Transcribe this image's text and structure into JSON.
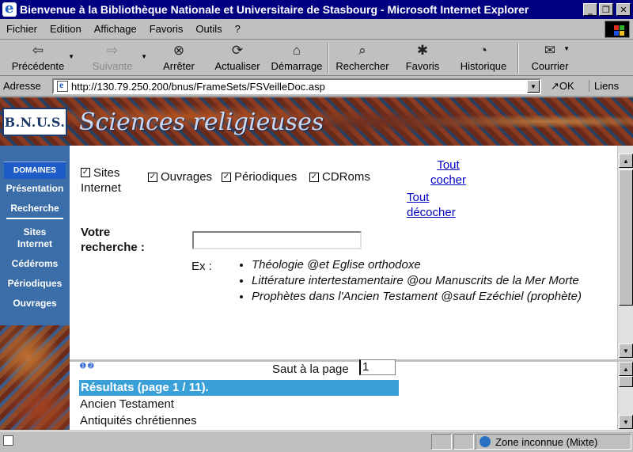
{
  "window": {
    "title": "Bienvenue à la Bibliothèque Nationale et Universitaire de Stasbourg - Microsoft Internet Explorer",
    "minimize": "_",
    "maximize": "❐",
    "close": "✕"
  },
  "menu": [
    "Fichier",
    "Edition",
    "Affichage",
    "Favoris",
    "Outils",
    "?"
  ],
  "toolbar": {
    "back": "Précédente",
    "forward": "Suivante",
    "stop": "Arrêter",
    "refresh": "Actualiser",
    "home": "Démarrage",
    "search": "Rechercher",
    "favorites": "Favoris",
    "history": "Historique",
    "mail": "Courrier"
  },
  "address": {
    "label": "Adresse",
    "url": "http://130.79.250.200/bnus/FrameSets/FSVeilleDoc.asp",
    "go": "OK",
    "links": "Liens"
  },
  "banner": {
    "logo": "B.N.U.S.",
    "title": "Sciences religieuses"
  },
  "leftnav": {
    "domaines": "DOMAINES",
    "top": [
      "Présentation",
      "Recherche"
    ],
    "bottom": [
      "Sites Internet",
      "Cédéroms",
      "Périodiques",
      "Ouvrages"
    ]
  },
  "filters": {
    "sites_line1": "Sites",
    "sites_line2": "Internet",
    "ouvrages": "Ouvrages",
    "periodiques": "Périodiques",
    "cdroms": "CDRoms",
    "check_mark": "✓",
    "select_all_1": "Tout",
    "select_all_2": "cocher",
    "deselect_all_1": "Tout",
    "deselect_all_2": "décocher"
  },
  "search": {
    "label_line1": "Votre",
    "label_line2": "recherche :",
    "value": "",
    "examples_label": "Ex :",
    "examples": [
      "Théologie @et Eglise orthodoxe",
      "Littérature intertestamentaire @ou Manuscrits de la Mer Morte",
      "Prophètes dans l'Ancien Testament @sauf Ezéchiel (prophète)"
    ]
  },
  "results": {
    "jump_label": "Saut à la page",
    "page_value": "1",
    "header": "Résultats (page 1 / 11).",
    "items": [
      "Ancien Testament",
      "Antiquités chrétiennes"
    ]
  },
  "status": {
    "zone": "Zone inconnue (Mixte)"
  }
}
